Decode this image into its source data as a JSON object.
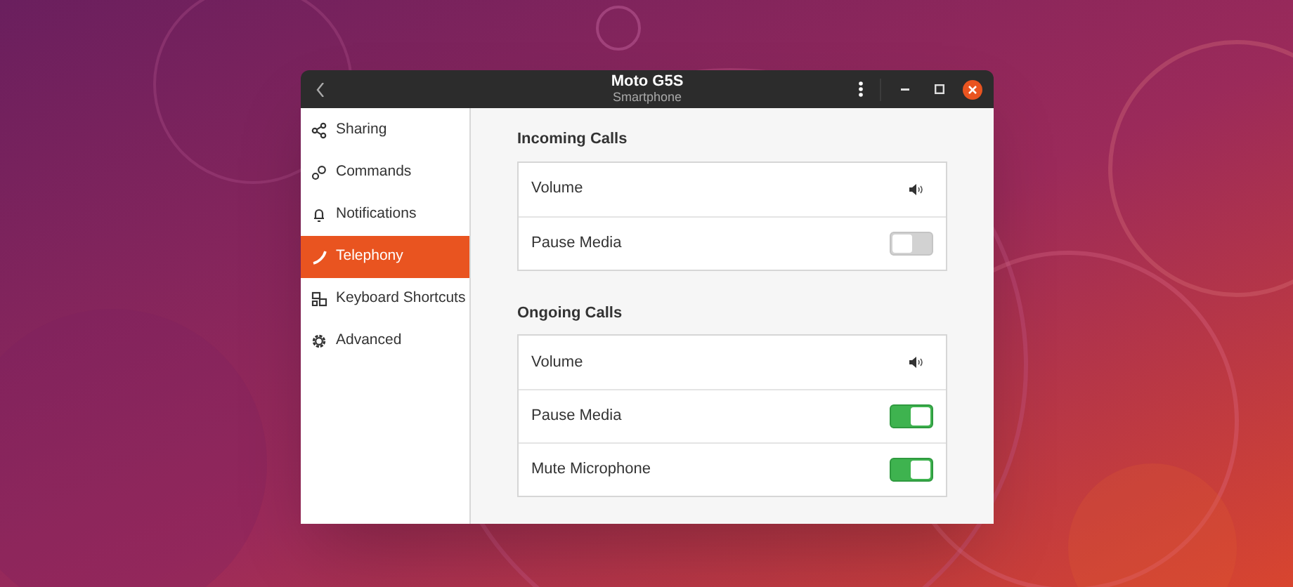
{
  "window": {
    "title": "Moto G5S",
    "subtitle": "Smartphone"
  },
  "sidebar": {
    "items": [
      {
        "label": "Sharing",
        "selected": false
      },
      {
        "label": "Commands",
        "selected": false
      },
      {
        "label": "Notifications",
        "selected": false
      },
      {
        "label": "Telephony",
        "selected": true
      },
      {
        "label": "Keyboard Shortcuts",
        "selected": false
      },
      {
        "label": "Advanced",
        "selected": false
      }
    ]
  },
  "sections": [
    {
      "title": "Incoming Calls",
      "rows": [
        {
          "kind": "volume",
          "label": "Volume"
        },
        {
          "kind": "switch",
          "label": "Pause Media",
          "on": false
        }
      ]
    },
    {
      "title": "Ongoing Calls",
      "rows": [
        {
          "kind": "volume",
          "label": "Volume"
        },
        {
          "kind": "switch",
          "label": "Pause Media",
          "on": true
        },
        {
          "kind": "switch",
          "label": "Mute Microphone",
          "on": true
        }
      ]
    }
  ]
}
